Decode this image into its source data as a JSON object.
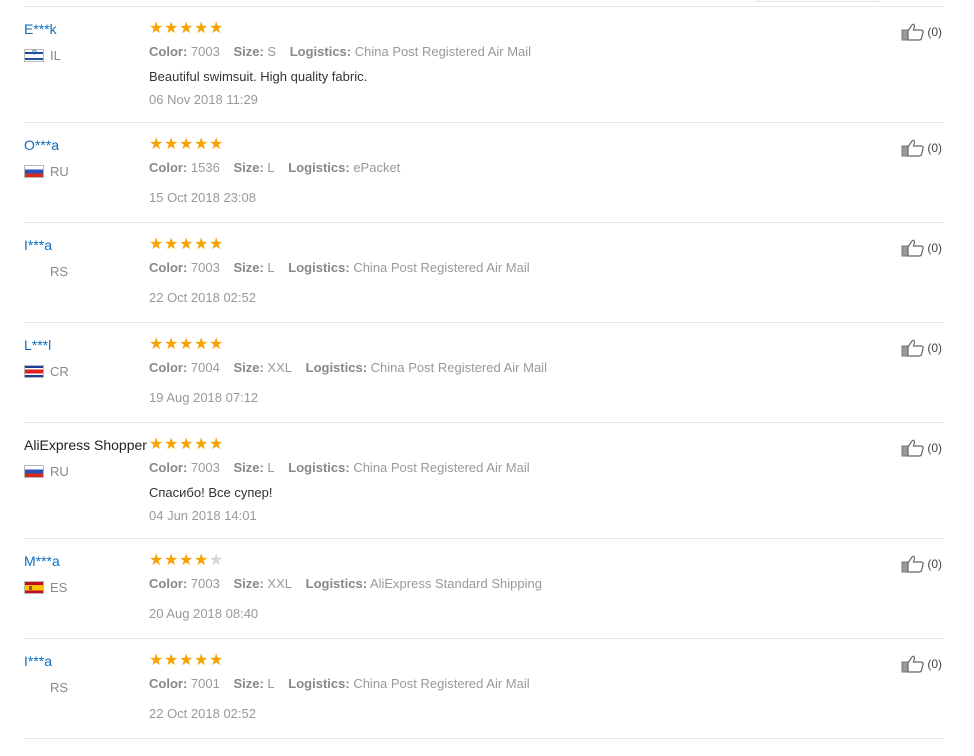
{
  "colors": {
    "username": "#0b6ec1",
    "star": "#f5a300",
    "star_empty": "#d6d6d6",
    "meta_text": "#999999"
  },
  "labels": {
    "color": "Color:",
    "size": "Size:",
    "logistics": "Logistics:"
  },
  "reviews": [
    {
      "user": "E***k",
      "country": "IL",
      "flag": "il",
      "rating": 5,
      "color": "7003",
      "size": "S",
      "logistics": "China Post Registered Air Mail",
      "text": "Beautiful swimsuit. High quality fabric.",
      "date": "06 Nov 2018 11:29",
      "likes": "(0)"
    },
    {
      "user": "O***a",
      "country": "RU",
      "flag": "ru",
      "rating": 5,
      "color": "1536",
      "size": "L",
      "logistics": "ePacket",
      "text": "",
      "date": "15 Oct 2018 23:08",
      "likes": "(0)"
    },
    {
      "user": "I***a",
      "country": "RS",
      "flag": "",
      "rating": 5,
      "color": "7003",
      "size": "L",
      "logistics": "China Post Registered Air Mail",
      "text": "",
      "date": "22 Oct 2018 02:52",
      "likes": "(0)"
    },
    {
      "user": "L***l",
      "country": "CR",
      "flag": "cr",
      "rating": 5,
      "color": "7004",
      "size": "XXL",
      "logistics": "China Post Registered Air Mail",
      "text": "",
      "date": "19 Aug 2018 07:12",
      "likes": "(0)"
    },
    {
      "user": "AliExpress Shopper",
      "country": "RU",
      "flag": "ru",
      "rating": 5,
      "color": "7003",
      "size": "L",
      "logistics": "China Post Registered Air Mail",
      "text": "Спасибо! Все супер!",
      "date": "04 Jun 2018 14:01",
      "likes": "(0)"
    },
    {
      "user": "M***a",
      "country": "ES",
      "flag": "es",
      "rating": 4,
      "color": "7003",
      "size": "XXL",
      "logistics": "AliExpress Standard Shipping",
      "text": "",
      "date": "20 Aug 2018 08:40",
      "likes": "(0)"
    },
    {
      "user": "I***a",
      "country": "RS",
      "flag": "",
      "rating": 5,
      "color": "7001",
      "size": "L",
      "logistics": "China Post Registered Air Mail",
      "text": "",
      "date": "22 Oct 2018 02:52",
      "likes": "(0)"
    }
  ]
}
